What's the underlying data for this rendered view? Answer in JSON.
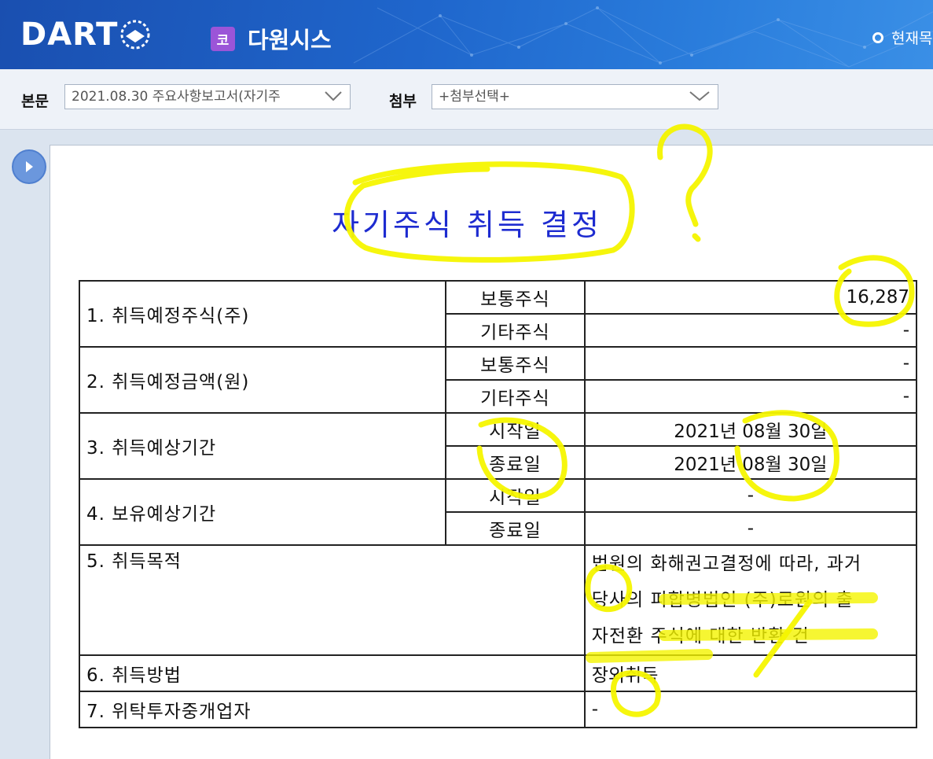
{
  "header": {
    "logo": "DART",
    "market_badge": "코",
    "company_name": "다원시스",
    "current_label": "현재목"
  },
  "toolbar": {
    "main_label": "본문",
    "main_select_value": "2021.08.30  주요사항보고서(자기주",
    "attach_label": "첨부",
    "attach_select_value": "+첨부선택+"
  },
  "document": {
    "title": "자기주식 취득 결정",
    "rows": {
      "r1_label": "1. 취득예정주식(주)",
      "r1a_sub": "보통주식",
      "r1a_val": "16,287",
      "r1b_sub": "기타주식",
      "r1b_val": "-",
      "r2_label": "2. 취득예정금액(원)",
      "r2a_sub": "보통주식",
      "r2a_val": "-",
      "r2b_sub": "기타주식",
      "r2b_val": "-",
      "r3_label": "3. 취득예상기간",
      "r3a_sub": "시작일",
      "r3a_val": "2021년 08월 30일",
      "r3b_sub": "종료일",
      "r3b_val": "2021년 08월 30일",
      "r4_label": "4. 보유예상기간",
      "r4a_sub": "시작일",
      "r4a_val": "-",
      "r4b_sub": "종료일",
      "r4b_val": "-",
      "r5_label": "5. 취득목적",
      "r5_line1": "법원의 화해권고결정에 따라, 과거",
      "r5_line2": "당사의 피합병법인 (주)로원의 출",
      "r5_line3": "자전환 주식에 대한 반환 건",
      "r6_label": "6. 취득방법",
      "r6_val": "장외취득",
      "r7_label": "7. 위탁투자중개업자",
      "r7_val": "-"
    }
  },
  "annotations": {
    "color": "#f5f500",
    "question_mark": "?"
  }
}
